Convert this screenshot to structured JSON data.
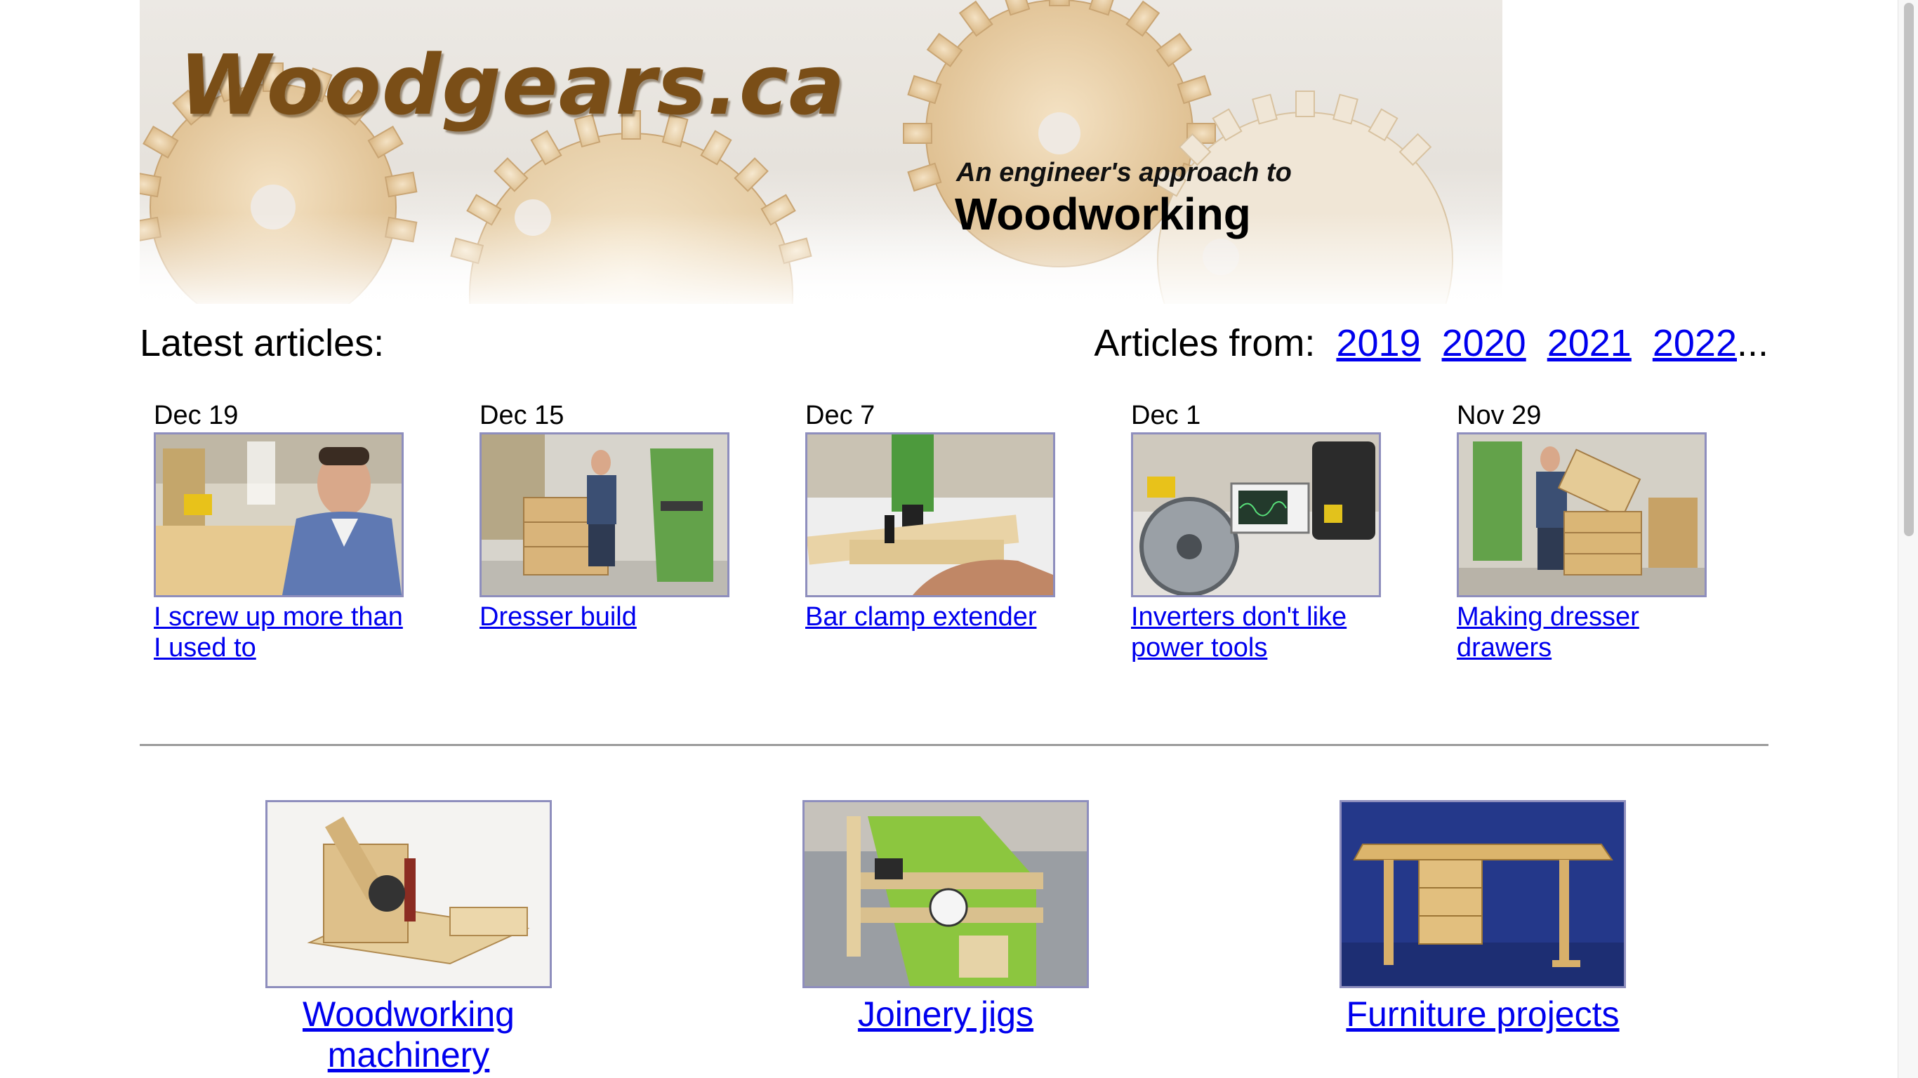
{
  "site": {
    "logo_text": "Woodgears.ca",
    "tagline_small": "An engineer's approach to",
    "tagline_large": "Woodworking"
  },
  "latest": {
    "heading": "Latest articles:",
    "articles_from_label": "Articles from:",
    "years": [
      "2019",
      "2020",
      "2021",
      "2022"
    ],
    "years_suffix": "...",
    "items": [
      {
        "date": "Dec 19",
        "title": "I screw up more than I used to",
        "thumb_icon": "man-in-workshop-photo"
      },
      {
        "date": "Dec 15",
        "title": "Dresser build",
        "thumb_icon": "dresser-and-bandsaw-photo"
      },
      {
        "date": "Dec 7",
        "title": "Bar clamp extender",
        "thumb_icon": "drilling-clamp-photo"
      },
      {
        "date": "Dec 1",
        "title": "Inverters don't like power tools",
        "thumb_icon": "circular-saw-oscilloscope-photo"
      },
      {
        "date": "Nov 29",
        "title": "Making dresser drawers",
        "thumb_icon": "man-holding-drawer-photo"
      }
    ]
  },
  "categories": [
    {
      "label": "Woodworking machinery",
      "thumb_icon": "mortising-machine-photo"
    },
    {
      "label": "Joinery jigs",
      "thumb_icon": "tablesaw-jig-photo"
    },
    {
      "label": "Furniture projects",
      "thumb_icon": "wooden-desk-photo"
    }
  ],
  "colors": {
    "link": "#0000ee",
    "thumb_border": "#8e8ebd",
    "logo_brown": "#7a4e17",
    "divider": "#9a9a9a"
  }
}
